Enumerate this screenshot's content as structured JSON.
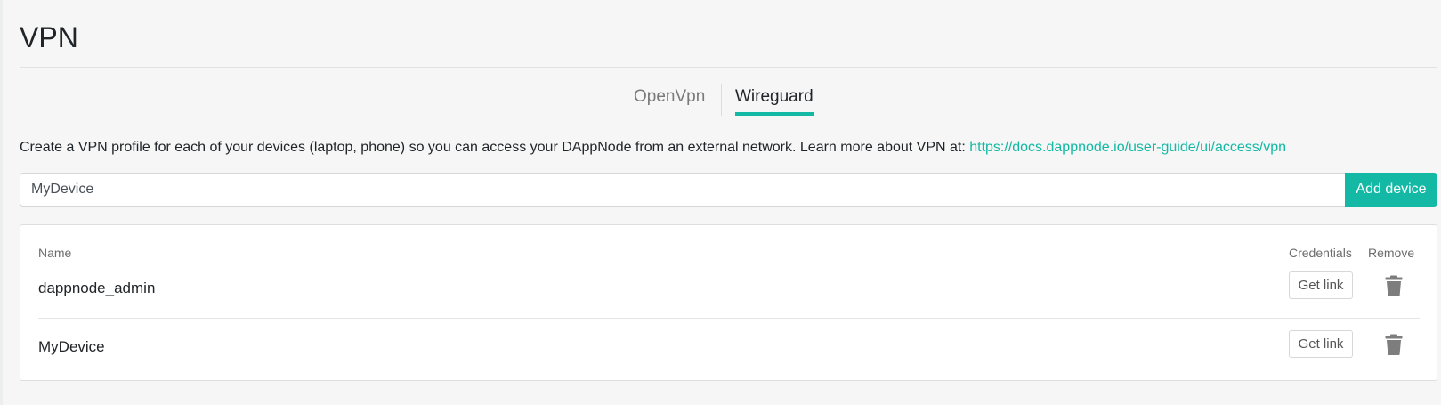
{
  "page": {
    "title": "VPN"
  },
  "tabs": [
    {
      "label": "OpenVpn",
      "active": false
    },
    {
      "label": "Wireguard",
      "active": true
    }
  ],
  "description": {
    "text": "Create a VPN profile for each of your devices (laptop, phone) so you can access your DAppNode from an external network. Learn more about VPN at: ",
    "link_text": "https://docs.dappnode.io/user-guide/ui/access/vpn"
  },
  "add_device": {
    "input_value": "MyDevice",
    "button_label": "Add device"
  },
  "table": {
    "headers": {
      "name": "Name",
      "credentials": "Credentials",
      "remove": "Remove"
    },
    "rows": [
      {
        "name": "dappnode_admin",
        "credentials_label": "Get link",
        "remove_icon": "trash-icon"
      },
      {
        "name": "MyDevice",
        "credentials_label": "Get link",
        "remove_icon": "trash-icon"
      }
    ]
  },
  "colors": {
    "accent": "#13b9a4",
    "background": "#f5f6f5",
    "icon": "#7d7d7d"
  }
}
